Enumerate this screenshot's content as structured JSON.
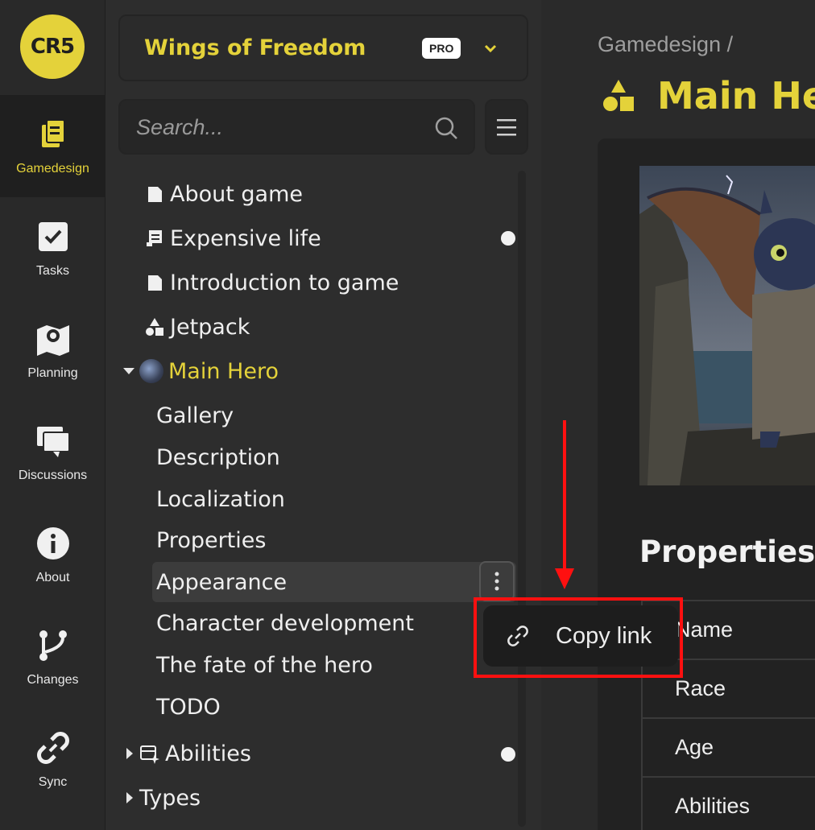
{
  "brand": {
    "logo_text": "CR5",
    "accent": "#e4d23a"
  },
  "rail": [
    {
      "label": "Gamedesign",
      "icon": "documents-icon",
      "active": true
    },
    {
      "label": "Tasks",
      "icon": "checkbox-icon"
    },
    {
      "label": "Planning",
      "icon": "map-icon"
    },
    {
      "label": "Discussions",
      "icon": "chat-icon"
    },
    {
      "label": "About",
      "icon": "info-icon"
    },
    {
      "label": "Changes",
      "icon": "branch-icon"
    },
    {
      "label": "Sync",
      "icon": "link-icon"
    }
  ],
  "project": {
    "name": "Wings of Freedom",
    "badge": "PRO"
  },
  "search": {
    "placeholder": "Search..."
  },
  "tree": {
    "about_game": "About game",
    "expensive_life": "Expensive life",
    "introduction": "Introduction to game",
    "jetpack": "Jetpack",
    "main_hero": "Main Hero",
    "children": [
      "Gallery",
      "Description",
      "Localization",
      "Properties",
      "Appearance",
      "Character development",
      "The fate of the hero",
      "TODO"
    ],
    "abilities": "Abilities",
    "types": "Types"
  },
  "context_menu": {
    "copy_link": "Copy link"
  },
  "main": {
    "breadcrumb": "Gamedesign /",
    "title": "Main Her",
    "properties_heading": "Properties",
    "properties": [
      "Name",
      "Race",
      "Age",
      "Abilities"
    ]
  }
}
